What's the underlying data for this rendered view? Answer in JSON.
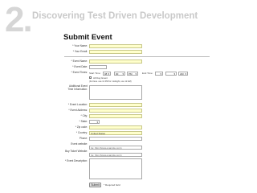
{
  "header": {
    "step_number": "2.",
    "banner_title": "Discovering Test Driven Development",
    "page_title": "Submit Event"
  },
  "form": {
    "your_name_label": "* Your Name:",
    "your_email_label": "* Your Email:",
    "event_name_label": "* Event Name:",
    "event_date_label": "* Event Date:",
    "event_times_label": "* Event Times:",
    "start_time_label": "Start Time:",
    "start_hour_value": "08",
    "start_min_value": "00",
    "start_ampm_value": "PM",
    "end_time_label": "End Time:",
    "end_ampm_value": "AM",
    "all_day_label": "All Day Event",
    "time_hint": "(For Exa. use 12 PM for midnight, use 12 AM)",
    "additional_info_label": "Additional Event Time Information:",
    "event_location_label": "* Event Location:",
    "event_address_label": "* Event Address:",
    "city_label": "* City:",
    "state_label": "* State:",
    "zip_label": "* Zip code:",
    "country_label": "* Country:",
    "country_value": "United States",
    "phone_label": "Phone:",
    "event_website_label": "Event website:",
    "event_website_value": "(ie: http://www.example.com)",
    "buy_tickets_label": "Buy Ticket Website:",
    "buy_tickets_value": "(ie: http://www.example.com)",
    "event_description_label": "* Event Description:",
    "submit_label": "Submit",
    "required_note": "* Required field"
  },
  "colors": {
    "required_field_bg": "#ffffcc",
    "banner_gray": "#c9c9c9"
  }
}
